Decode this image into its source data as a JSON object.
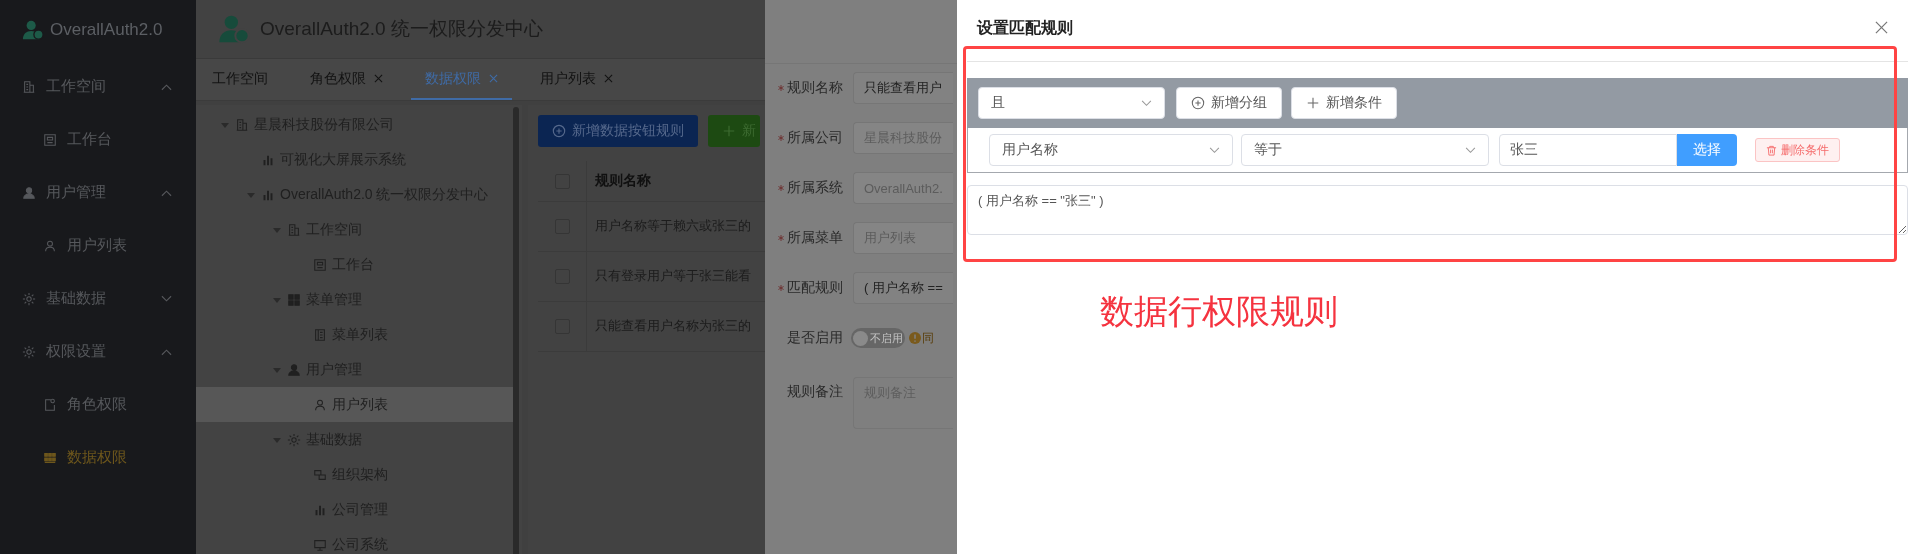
{
  "sidebar": {
    "logo": "OverallAuth2.0",
    "groups": [
      {
        "label": "工作空间",
        "kind": "building",
        "expanded": true,
        "children": [
          {
            "label": "工作台",
            "kind": "desk",
            "selected": false
          }
        ]
      },
      {
        "label": "用户管理",
        "kind": "user",
        "expanded": true,
        "children": [
          {
            "label": "用户列表",
            "kind": "user-outline",
            "selected": false
          }
        ]
      },
      {
        "label": "基础数据",
        "kind": "gear",
        "expanded": false
      },
      {
        "label": "权限设置",
        "kind": "gear",
        "expanded": true,
        "children": [
          {
            "label": "角色权限",
            "kind": "doc",
            "selected": false
          },
          {
            "label": "数据权限",
            "kind": "tiles",
            "selected": true
          }
        ]
      }
    ]
  },
  "header": {
    "title": "OverallAuth2.0 统一权限分发中心"
  },
  "tabs": [
    {
      "label": "工作空间",
      "closable": false,
      "selected": false
    },
    {
      "label": "角色权限",
      "closable": true,
      "selected": false
    },
    {
      "label": "数据权限",
      "closable": true,
      "selected": true
    },
    {
      "label": "用户列表",
      "closable": true,
      "selected": false
    }
  ],
  "tree": {
    "nodes": [
      {
        "label": "星晨科技股份有限公司",
        "kind": "building",
        "selected": false,
        "expanded": true,
        "children": [
          {
            "label": "可视化大屏展示系统",
            "kind": "chart",
            "selected": false
          },
          {
            "label": "OverallAuth2.0 统一权限分发中心",
            "kind": "chart",
            "selected": false,
            "expanded": true,
            "children": [
              {
                "label": "工作空间",
                "kind": "building",
                "selected": false,
                "expanded": true,
                "children": [
                  {
                    "label": "工作台",
                    "kind": "desk",
                    "selected": false
                  }
                ]
              },
              {
                "label": "菜单管理",
                "kind": "grid",
                "selected": false,
                "expanded": true,
                "children": [
                  {
                    "label": "菜单列表",
                    "kind": "list",
                    "selected": false
                  }
                ]
              },
              {
                "label": "用户管理",
                "kind": "user",
                "selected": false,
                "expanded": true,
                "children": [
                  {
                    "label": "用户列表",
                    "kind": "user-outline",
                    "selected": true
                  }
                ]
              },
              {
                "label": "基础数据",
                "kind": "gear",
                "selected": false,
                "expanded": true,
                "children": [
                  {
                    "label": "组织架构",
                    "kind": "org",
                    "selected": false
                  },
                  {
                    "label": "公司管理",
                    "kind": "chart",
                    "selected": false
                  },
                  {
                    "label": "公司系统",
                    "kind": "monitor",
                    "selected": false
                  }
                ]
              }
            ]
          }
        ]
      }
    ]
  },
  "table": {
    "buttons": [
      {
        "label": "新增数据按钮规则",
        "kind": "primary"
      },
      {
        "label": "新",
        "kind": "success"
      }
    ],
    "header_checked": false,
    "columns": [
      "规则名称"
    ],
    "rows": [
      {
        "checked": false,
        "cells": [
          "用户名称等于赖六或张三的"
        ]
      },
      {
        "checked": false,
        "cells": [
          "只有登录用户等于张三能看"
        ]
      },
      {
        "checked": false,
        "cells": [
          "只能查看用户名称为张三的"
        ]
      }
    ]
  },
  "drawer": {
    "fields": [
      {
        "label": "规则名称",
        "required": true,
        "kind": "input",
        "value": "只能查看用户",
        "disabled": false
      },
      {
        "label": "所属公司",
        "required": true,
        "kind": "input",
        "value": "星晨科技股份",
        "disabled": true
      },
      {
        "label": "所属系统",
        "required": true,
        "kind": "input",
        "value": "OverallAuth2.",
        "disabled": true
      },
      {
        "label": "所属菜单",
        "required": true,
        "kind": "input",
        "value": "用户列表",
        "disabled": true
      },
      {
        "label": "匹配规则",
        "required": true,
        "kind": "input",
        "value": "( 用户名称 ==",
        "disabled": false
      },
      {
        "label": "是否启用",
        "required": false,
        "kind": "switch",
        "on": false,
        "text": "不启用",
        "hint": "同"
      },
      {
        "label": "规则备注",
        "required": false,
        "kind": "textarea",
        "placeholder": "规则备注"
      }
    ]
  },
  "dialog": {
    "title": "设置匹配规则",
    "logic": "且",
    "group_buttons": [
      {
        "label": "新增分组",
        "kind": "plus-circle"
      },
      {
        "label": "新增条件",
        "kind": "plus"
      }
    ],
    "conditions": [
      {
        "field": "用户名称",
        "operator": "等于",
        "value": "张三",
        "pick": "选择",
        "remove": "删除条件"
      }
    ],
    "expression": "( 用户名称 == \"张三\" )"
  },
  "annotation": {
    "text": "数据行权限规则"
  }
}
